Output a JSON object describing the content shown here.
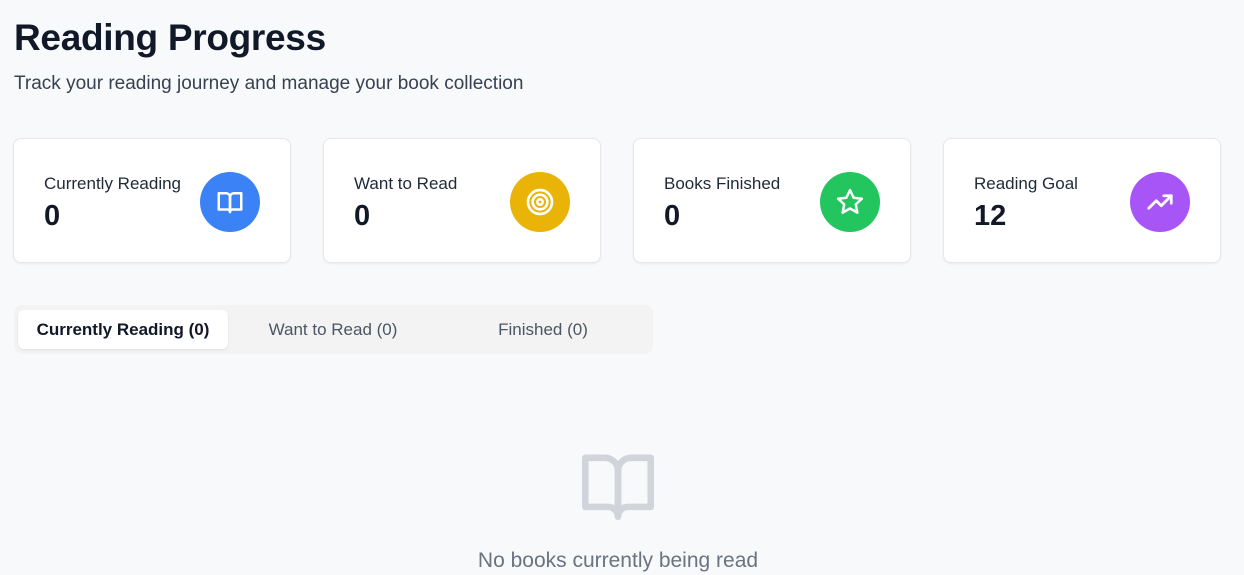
{
  "header": {
    "title": "Reading Progress",
    "subtitle": "Track your reading journey and manage your book collection"
  },
  "stats": [
    {
      "label": "Currently Reading",
      "value": "0",
      "icon": "book-open-icon",
      "color": "#3b82f6"
    },
    {
      "label": "Want to Read",
      "value": "0",
      "icon": "target-icon",
      "color": "#eab308"
    },
    {
      "label": "Books Finished",
      "value": "0",
      "icon": "star-icon",
      "color": "#22c55e"
    },
    {
      "label": "Reading Goal",
      "value": "12",
      "icon": "trending-up-icon",
      "color": "#a855f7"
    }
  ],
  "tabs": [
    {
      "label": "Currently Reading (0)",
      "active": true
    },
    {
      "label": "Want to Read (0)",
      "active": false
    },
    {
      "label": "Finished (0)",
      "active": false
    }
  ],
  "empty_state": {
    "icon": "book-open-icon",
    "message": "No books currently being read"
  }
}
